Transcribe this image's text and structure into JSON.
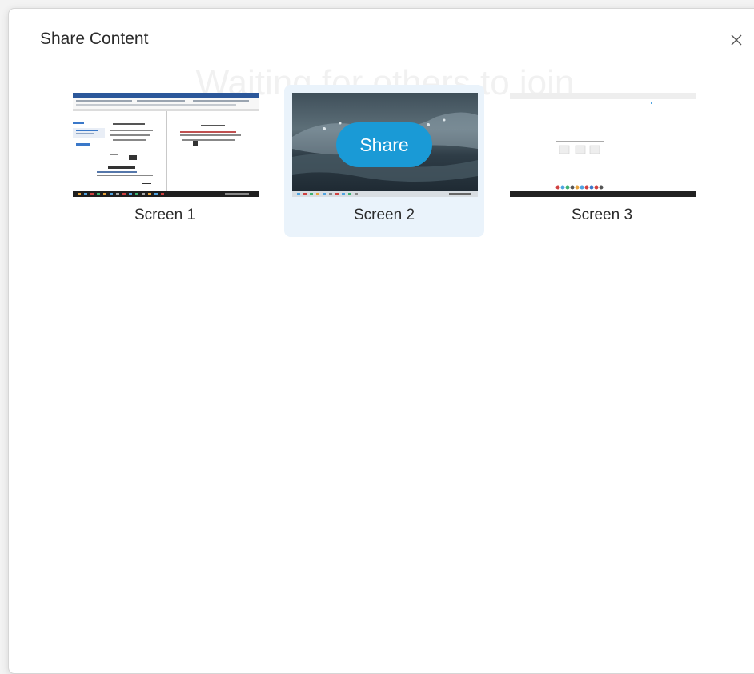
{
  "dialog": {
    "title": "Share Content",
    "background_text": "Waiting for others to join"
  },
  "screens": [
    {
      "label": "Screen 1",
      "selected": false
    },
    {
      "label": "Screen 2",
      "selected": true,
      "share_label": "Share"
    },
    {
      "label": "Screen 3",
      "selected": false
    }
  ],
  "icons": {
    "close": "close-icon"
  },
  "colors": {
    "accent": "#1a9ad6",
    "selected_bg": "#eaf3fb"
  }
}
